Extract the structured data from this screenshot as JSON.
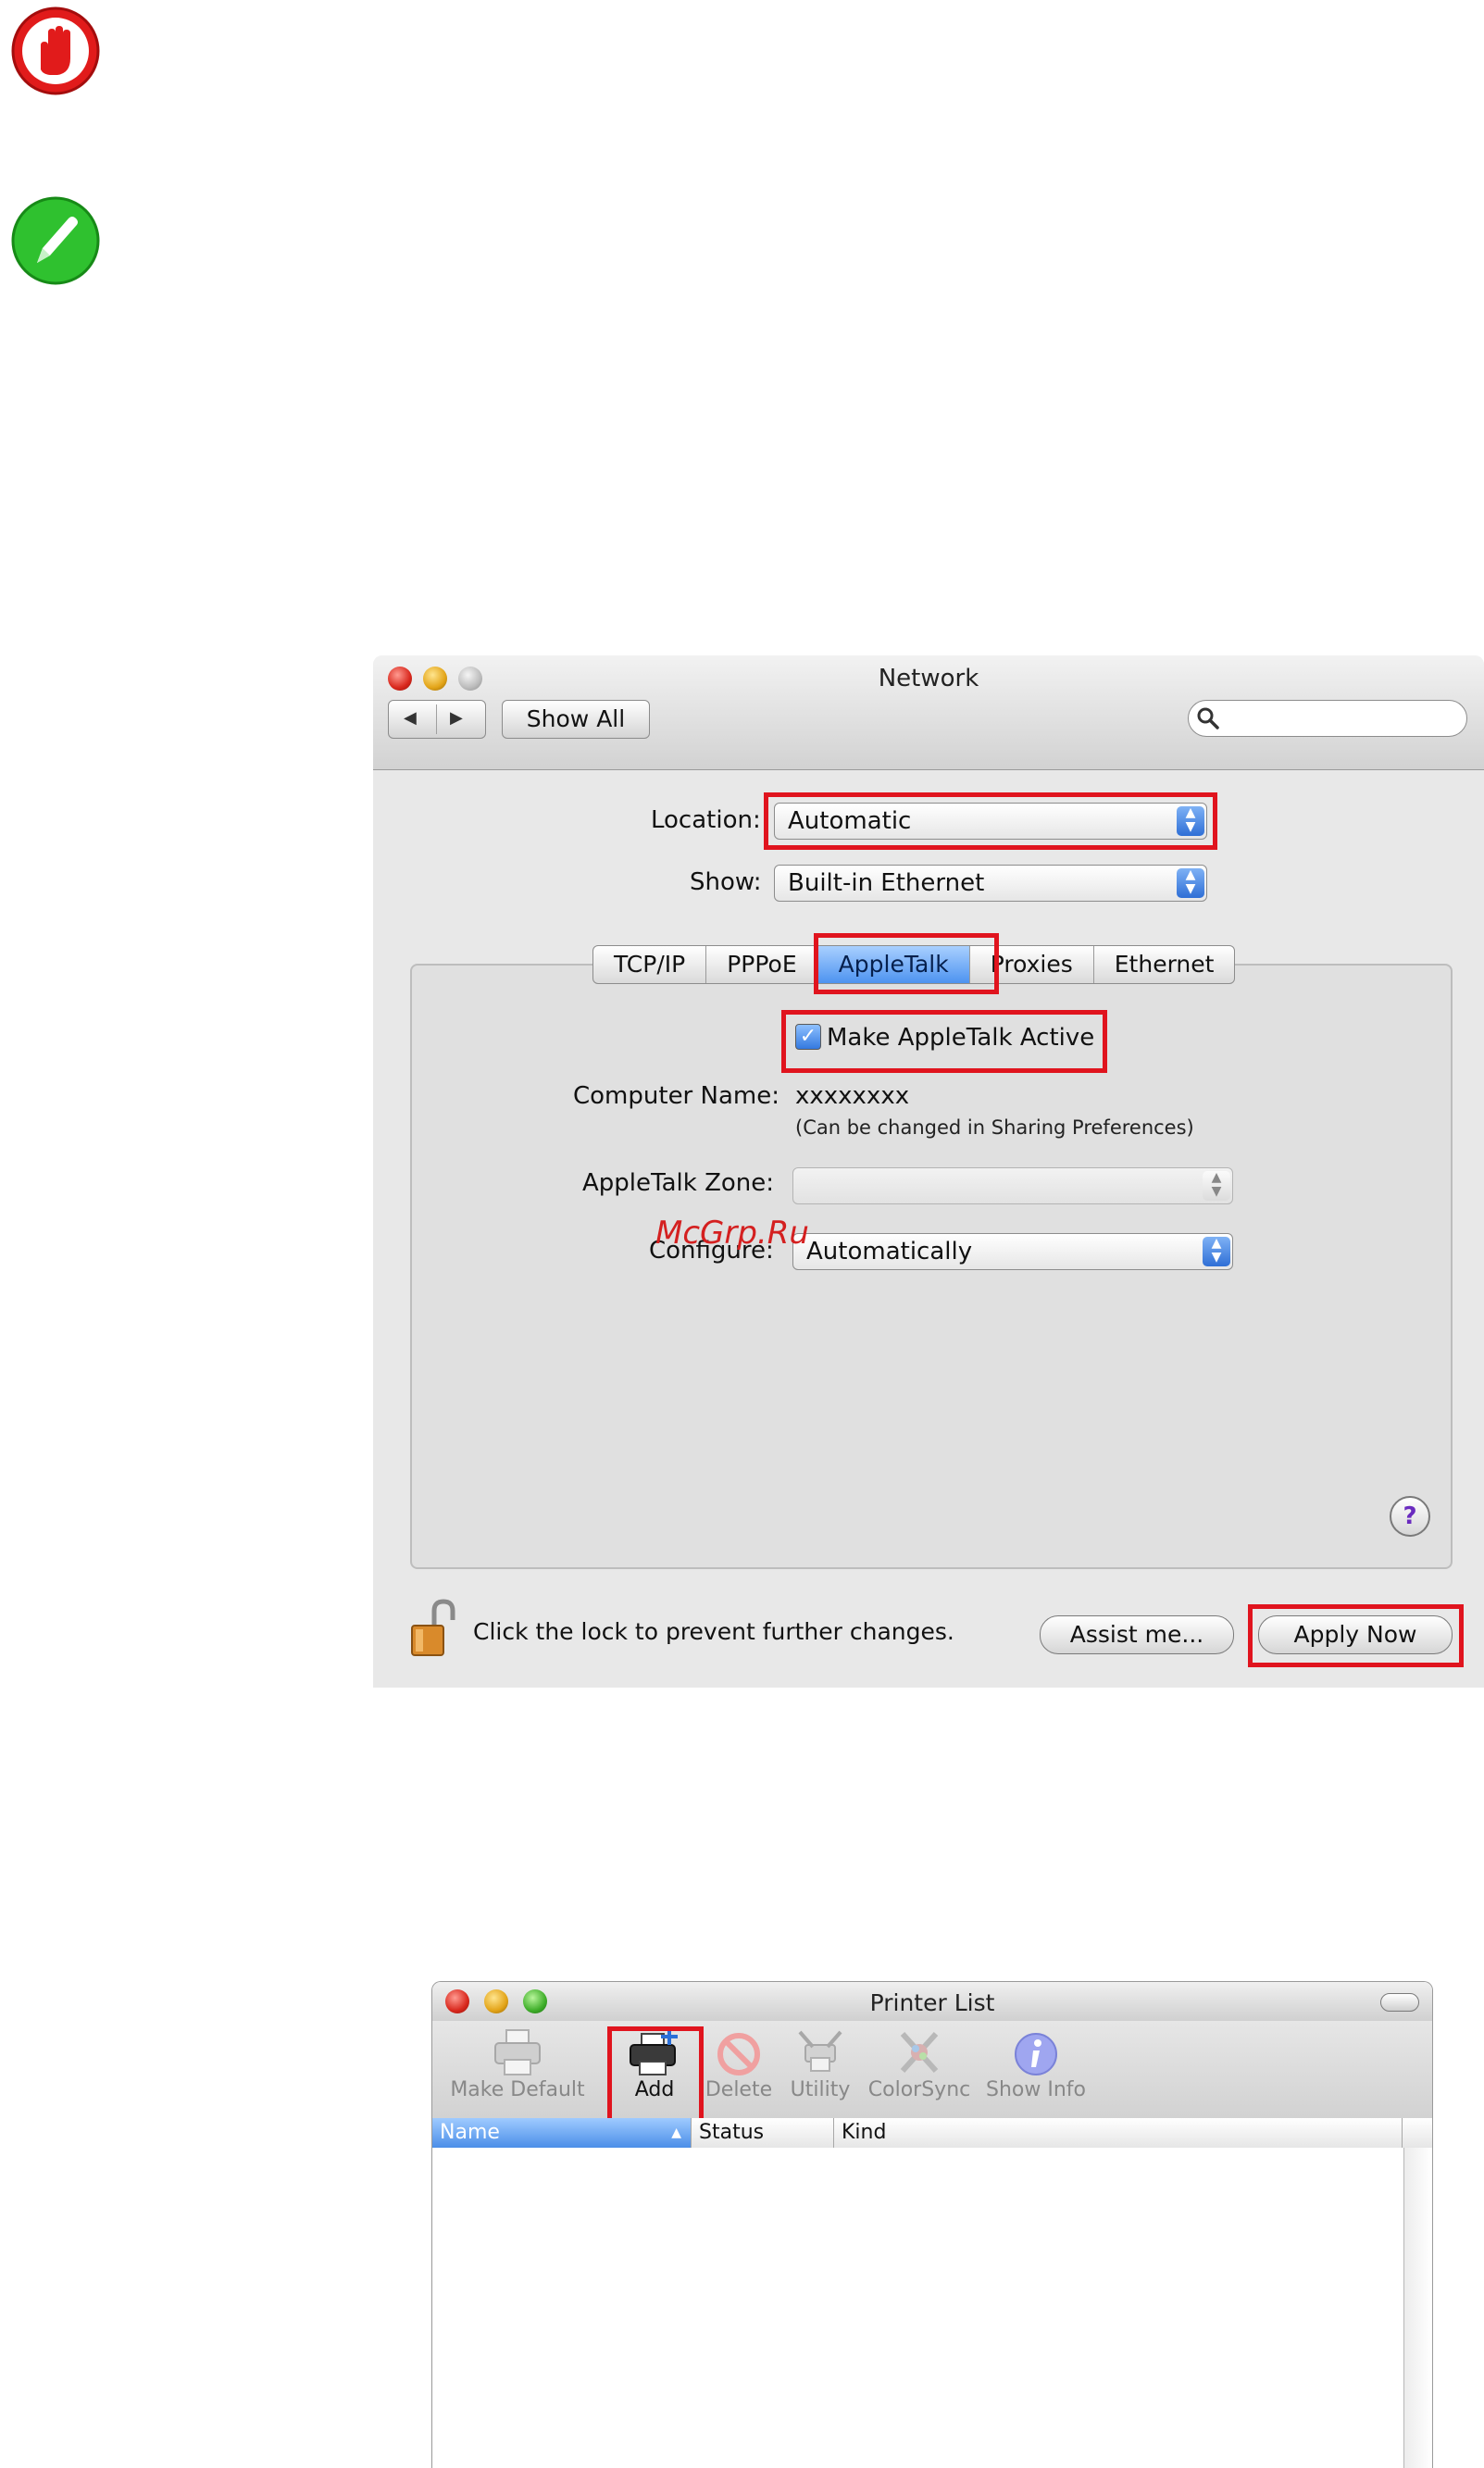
{
  "network": {
    "title": "Network",
    "nav_back": "◀",
    "nav_forward": "▶",
    "show_all": "Show All",
    "search_placeholder": "",
    "location_label": "Location:",
    "location_value": "Automatic",
    "show_label": "Show:",
    "show_value": "Built-in Ethernet",
    "tabs": [
      "TCP/IP",
      "PPPoE",
      "AppleTalk",
      "Proxies",
      "Ethernet"
    ],
    "active_tab": "AppleTalk",
    "make_active_label": "Make AppleTalk Active",
    "make_active_checked": true,
    "computer_name_label": "Computer Name:",
    "computer_name_value": "xxxxxxxx",
    "computer_name_hint": "(Can be changed in Sharing Preferences)",
    "zone_label": "AppleTalk Zone:",
    "zone_value": "",
    "configure_label": "Configure:",
    "configure_value": "Automatically",
    "help": "?",
    "lock_text": "Click the lock to prevent further changes.",
    "assist_button": "Assist me...",
    "apply_button": "Apply Now"
  },
  "watermark": "McGrp.Ru",
  "printer_list": {
    "title": "Printer List",
    "toolbar": [
      {
        "label": "Make Default",
        "enabled": false
      },
      {
        "label": "Add",
        "enabled": true
      },
      {
        "label": "Delete",
        "enabled": false
      },
      {
        "label": "Utility",
        "enabled": false
      },
      {
        "label": "ColorSync",
        "enabled": false
      },
      {
        "label": "Show Info",
        "enabled": false
      }
    ],
    "columns": [
      "Name",
      "Status",
      "Kind"
    ],
    "sort_indicator": "▲"
  },
  "colors": {
    "highlight_red": "#e0141e",
    "aqua_blue": "#4d93f0"
  }
}
